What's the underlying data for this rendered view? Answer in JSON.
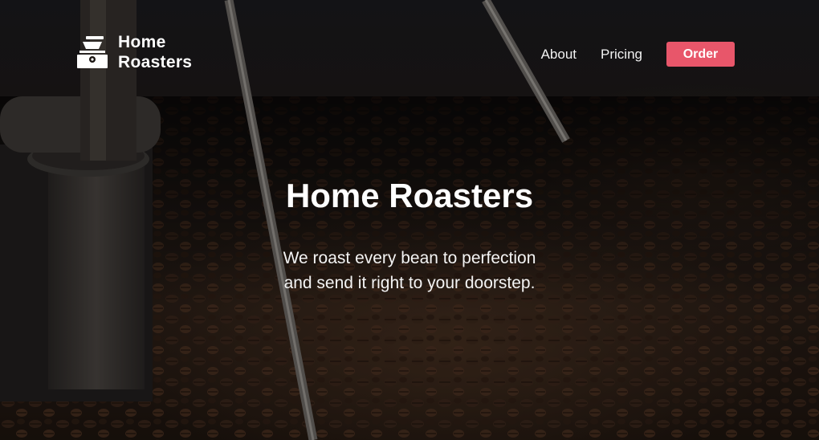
{
  "brand": {
    "line1": "Home",
    "line2": "Roasters",
    "icon": "coffee-grinder-icon"
  },
  "nav": {
    "about": "About",
    "pricing": "Pricing",
    "order": "Order"
  },
  "hero": {
    "title": "Home Roasters",
    "subtitle_line1": "We roast every bean to perfection",
    "subtitle_line2": "and send it right to your doorstep."
  },
  "colors": {
    "accent": "#e8566a",
    "text": "#ffffff"
  }
}
